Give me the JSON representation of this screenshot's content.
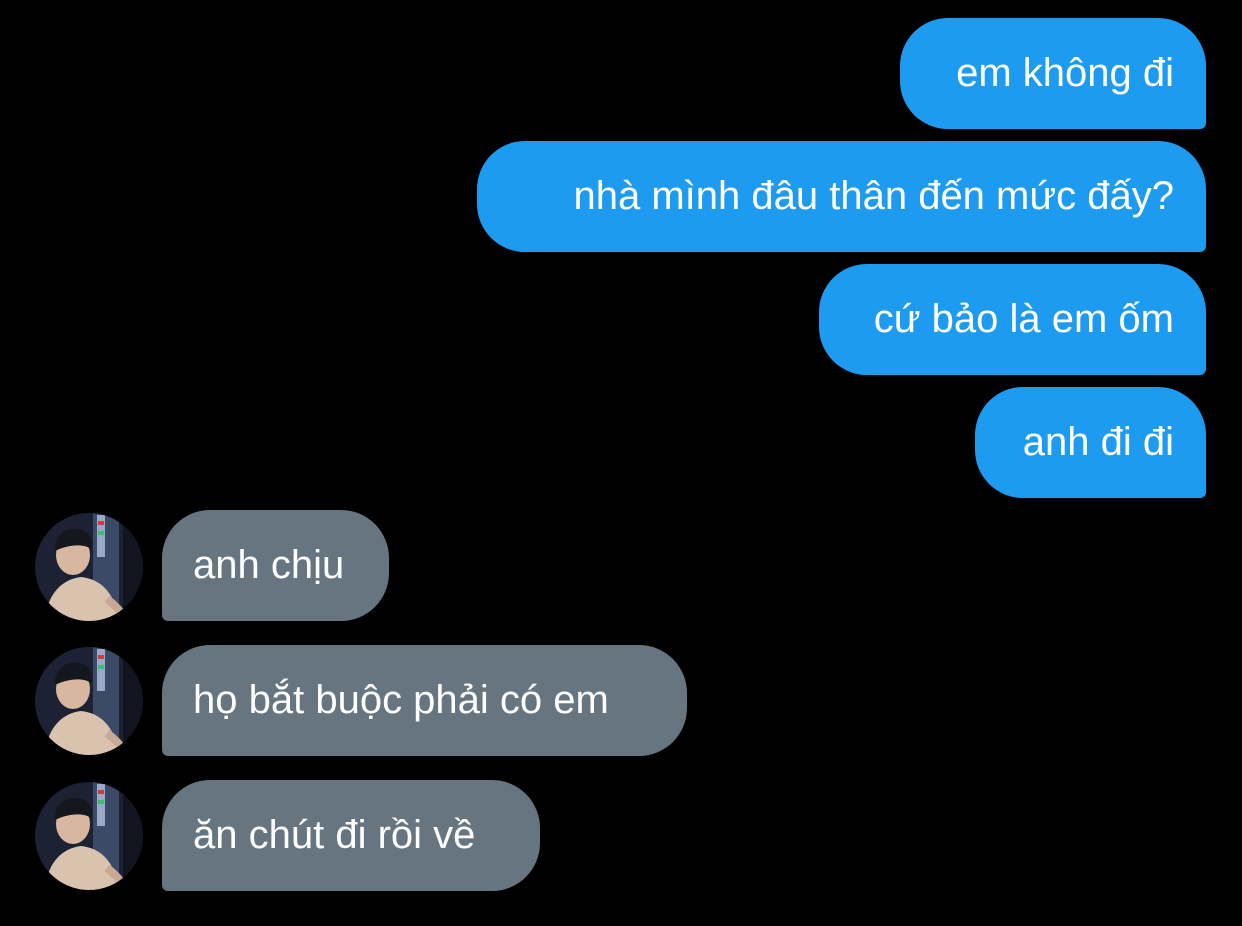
{
  "conversation": {
    "messages": [
      {
        "direction": "sent",
        "text": "em không đi"
      },
      {
        "direction": "sent",
        "text": "nhà mình đâu thân đến mức đấy?"
      },
      {
        "direction": "sent",
        "text": "cứ bảo là em ốm"
      },
      {
        "direction": "sent",
        "text": "anh đi đi"
      },
      {
        "direction": "received",
        "text": "anh chịu"
      },
      {
        "direction": "received",
        "text": "họ bắt buộc phải có em"
      },
      {
        "direction": "received",
        "text": "ăn chút đi rồi về"
      }
    ]
  },
  "colors": {
    "background": "#000000",
    "sent_bubble": "#1d9bf0",
    "received_bubble": "#66757f",
    "bubble_text": "#ffffff"
  },
  "icons": {
    "avatar": "contact-avatar-photo"
  }
}
